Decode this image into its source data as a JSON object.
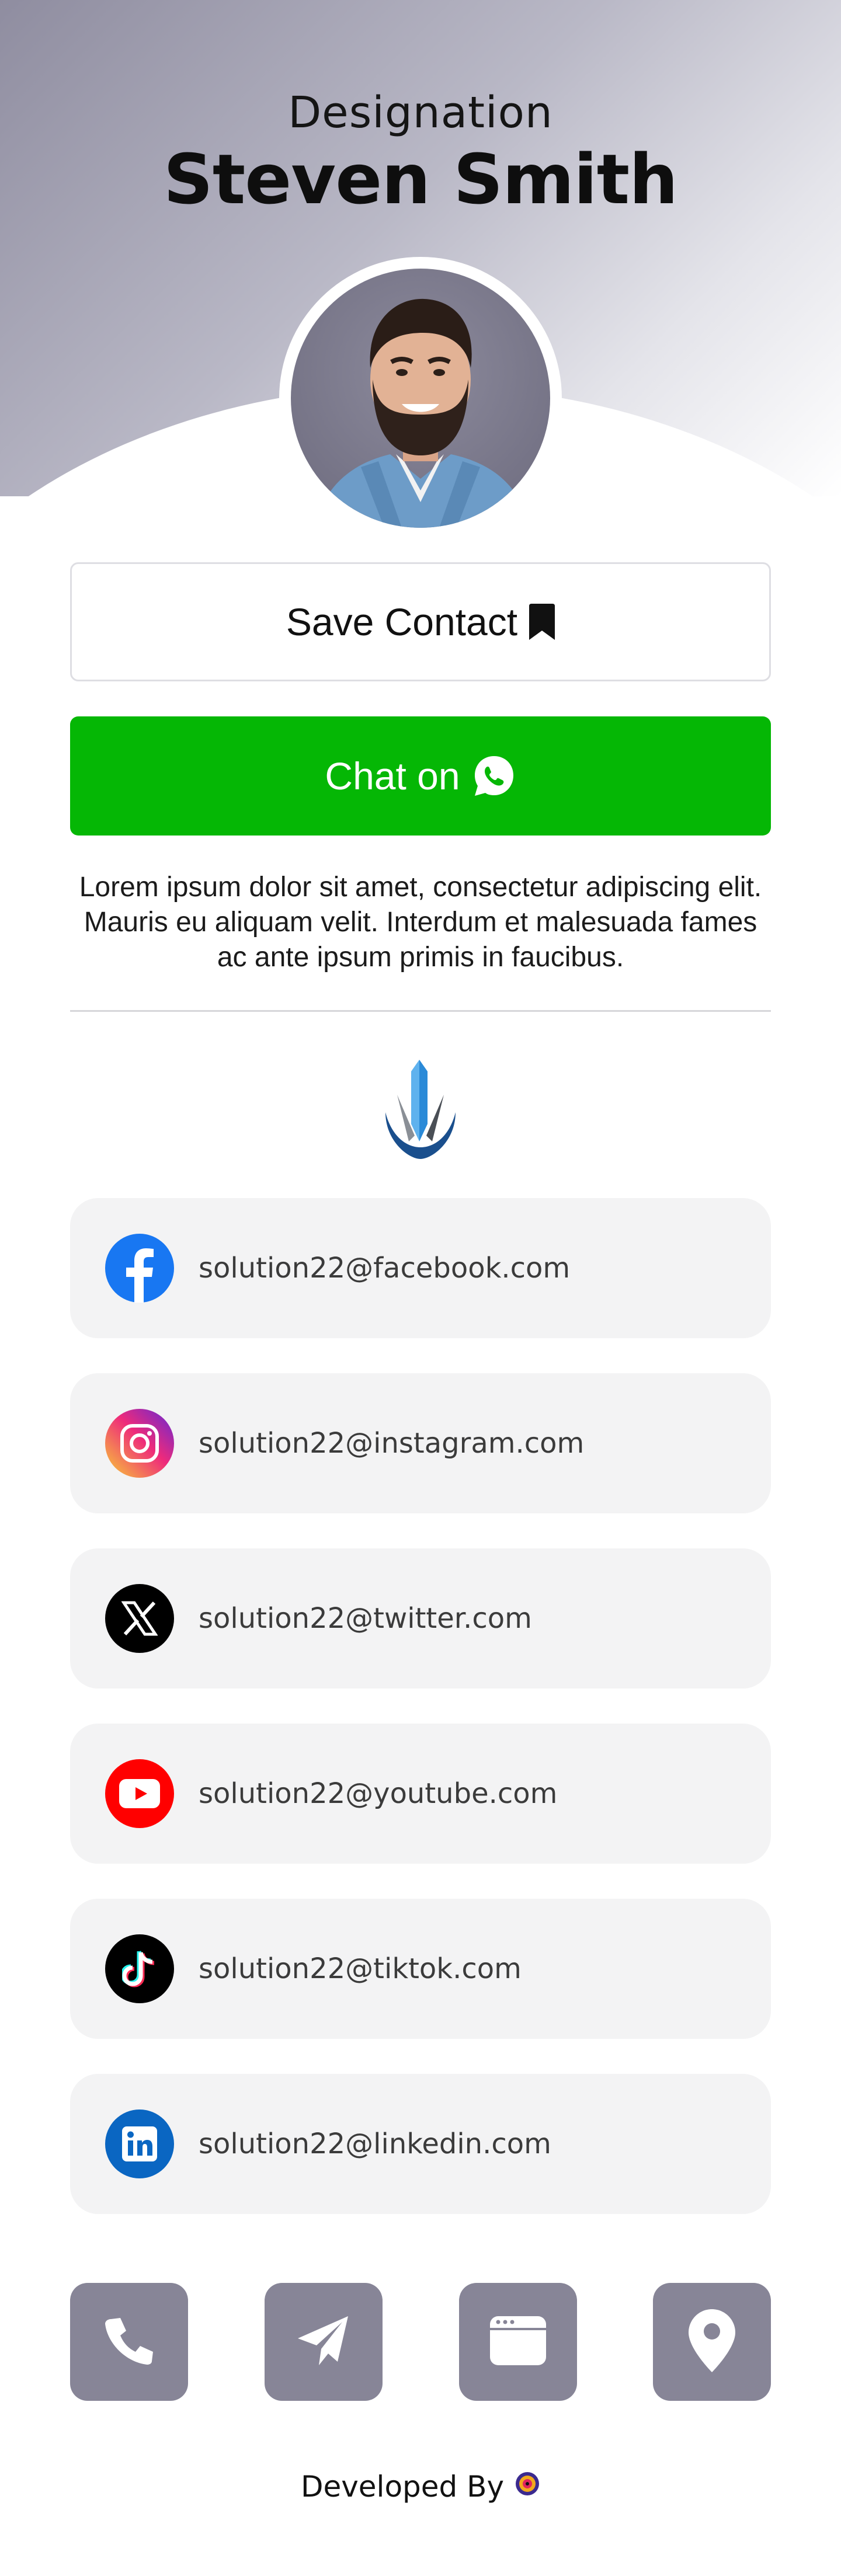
{
  "header": {
    "designation": "Designation",
    "name": "Steven Smith"
  },
  "buttons": {
    "save_label": "Save Contact",
    "chat_label": "Chat on",
    "save_icon": "bookmark-icon",
    "chat_icon": "whatsapp-icon"
  },
  "bio": "Lorem ipsum dolor sit amet, consectetur adipiscing elit. Mauris eu aliquam velit. Interdum et malesuada fames ac ante ipsum primis in faucibus.",
  "socials": [
    {
      "platform": "facebook",
      "icon": "facebook-icon",
      "text": "solution22@facebook.com",
      "color": "#1877f2"
    },
    {
      "platform": "instagram",
      "icon": "instagram-icon",
      "text": "solution22@instagram.com",
      "color": "#e1306c"
    },
    {
      "platform": "twitter",
      "icon": "x-icon",
      "text": "solution22@twitter.com",
      "color": "#000000"
    },
    {
      "platform": "youtube",
      "icon": "youtube-icon",
      "text": "solution22@youtube.com",
      "color": "#ff0000"
    },
    {
      "platform": "tiktok",
      "icon": "tiktok-icon",
      "text": "solution22@tiktok.com",
      "color": "#000000"
    },
    {
      "platform": "linkedin",
      "icon": "linkedin-icon",
      "text": "solution22@linkedin.com",
      "color": "#0a66c2"
    }
  ],
  "actions": [
    {
      "name": "call",
      "icon": "phone-icon"
    },
    {
      "name": "message",
      "icon": "send-icon"
    },
    {
      "name": "website",
      "icon": "browser-icon"
    },
    {
      "name": "location",
      "icon": "map-pin-icon"
    }
  ],
  "footer": {
    "label": "Developed By"
  },
  "colors": {
    "accent_green": "#05b705",
    "action_button": "#878597",
    "card_background": "#f3f3f4"
  }
}
